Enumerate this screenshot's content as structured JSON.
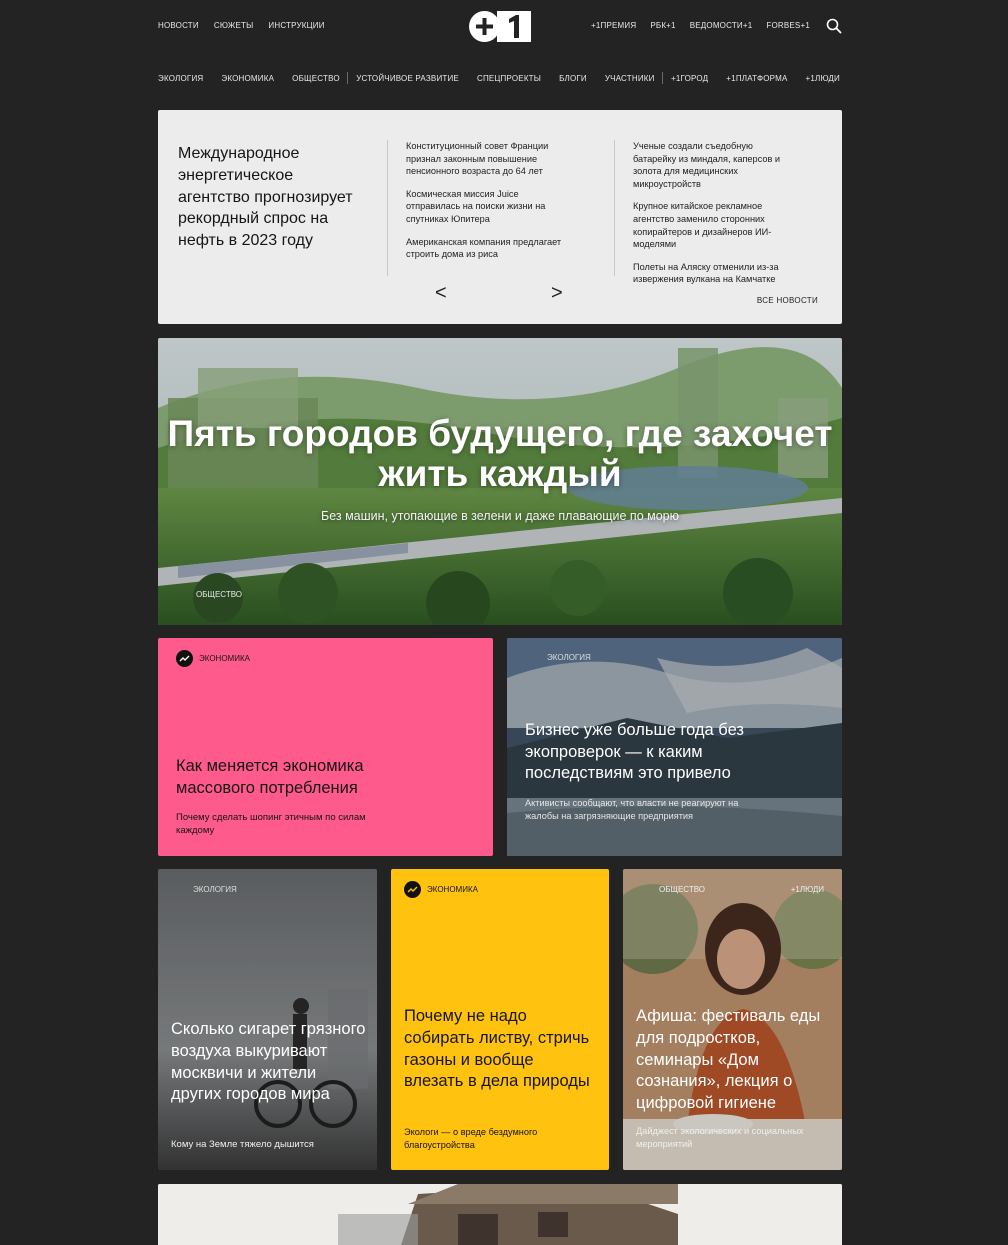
{
  "header": {
    "left_links": [
      "НОВОСТИ",
      "СЮЖЕТЫ",
      "ИНСТРУКЦИИ"
    ],
    "logo_text": "+1",
    "right_links": [
      "+1ПРЕМИЯ",
      "РБК+1",
      "ВЕДОМОСТИ+1",
      "FORBES+1"
    ]
  },
  "subnav": {
    "group1": [
      "ЭКОЛОГИЯ",
      "ЭКОНОМИКА",
      "ОБЩЕСТВО"
    ],
    "group2": [
      "УСТОЙЧИВОЕ РАЗВИТИЕ",
      "СПЕЦПРОЕКТЫ",
      "БЛОГИ",
      "УЧАСТНИКИ"
    ],
    "group3": [
      "+1ГОРОД",
      "+1ПЛАТФОРМА",
      "+1ЛЮДИ"
    ]
  },
  "news_panel": {
    "headline": "Международное энергетическое агентство прогнозирует рекордный спрос на нефть в 2023 году",
    "middle": [
      "Конституционный совет Франции признал законным повышение пенсионного возраста до 64 лет",
      "Космическая миссия Juice отправилась на поиски жизни на спутниках Юпитера",
      "Американская компания предлагает строить дома из риса"
    ],
    "right": [
      "Ученые создали съедобную батарейку из миндаля, каперсов и золота для медицинских микроустройств",
      "Крупное китайское рекламное агентство заменило сторонних копирайтеров и дизайнеров ИИ-моделями",
      "Полеты на Аляску отменили из-за извержения вулкана на Камчатке"
    ],
    "prev_arrow": "<",
    "next_arrow": ">",
    "all_news": "ВСЕ НОВОСТИ"
  },
  "hero": {
    "title": "Пять городов будущего, где захочет жить каждый",
    "subtitle": "Без машин, утопающие в зелени и даже плавающие по морю",
    "tag": "ОБЩЕСТВО"
  },
  "cards": {
    "pink": {
      "tag": "ЭКОНОМИКА",
      "title": "Как меняется экономика массового потребления",
      "subtitle": "Почему сделать шопинг этичным по силам каждому",
      "color": "#ff5a8c"
    },
    "lake": {
      "tag": "ЭКОЛОГИЯ",
      "title": "Бизнес уже больше года без экопроверок — к каким последствиям это привело",
      "subtitle": "Активисты сообщают, что власти не реагируют на жалобы на загрязняющие предприятия"
    },
    "smog": {
      "tag": "ЭКОЛОГИЯ",
      "title": "Сколько сигарет грязного воздуха выкуривают москвичи и жители других городов мира",
      "subtitle": "Кому на Земле тяжело дышится"
    },
    "yellow": {
      "tag": "ЭКОНОМИКА",
      "title": "Почему не надо собирать листву, стричь газоны и вообще влезать в дела природы",
      "subtitle": "Экологи — о вреде бездумного благоустройства",
      "color": "#ffc20e"
    },
    "woman": {
      "tag": "ОБЩЕСТВО",
      "tag2": "+1ЛЮДИ",
      "title": "Афиша: фестиваль еды для подростков, семинары «Дом сознания», лекция о цифровой гигиене",
      "subtitle": "Дайджест экологических и социальных мероприятий"
    }
  }
}
